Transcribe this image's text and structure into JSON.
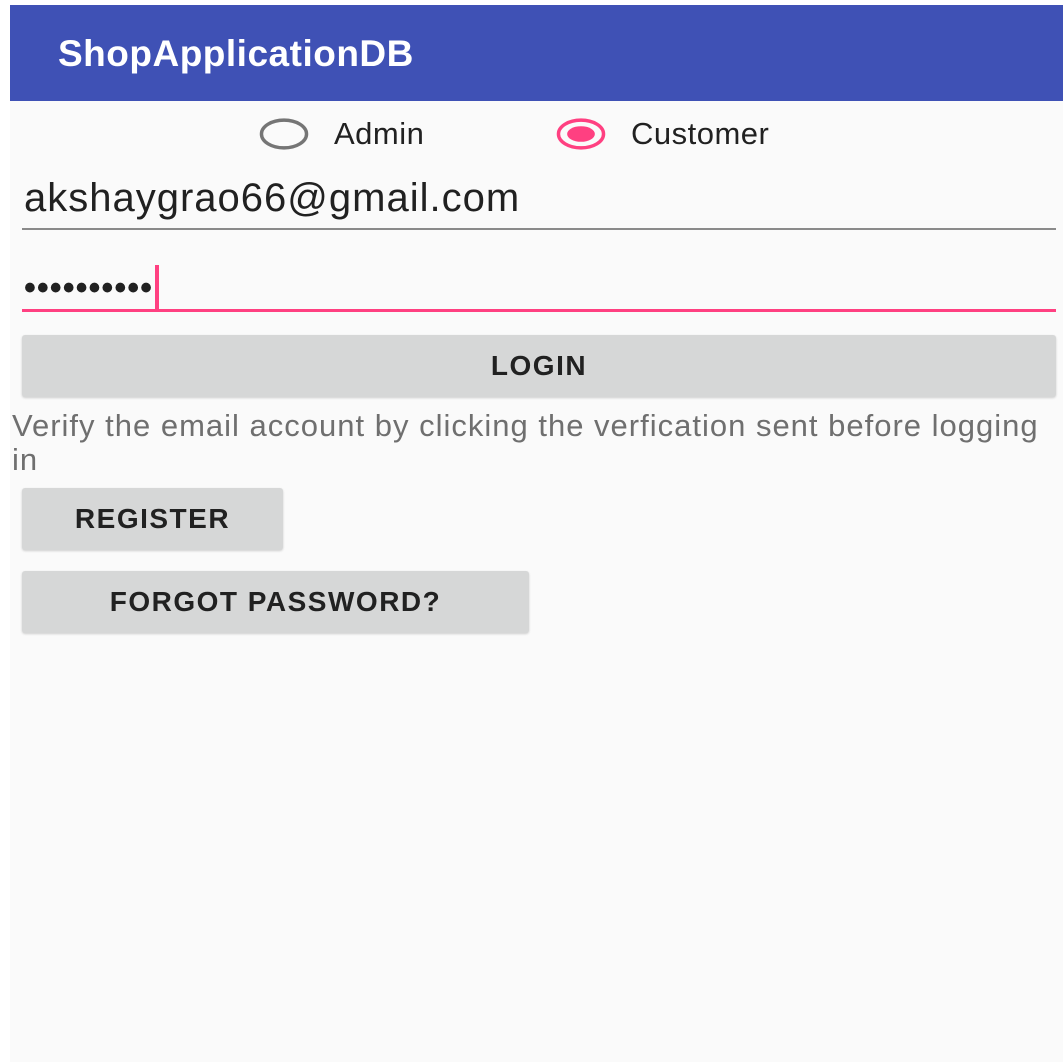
{
  "app": {
    "title": "ShopApplicationDB"
  },
  "role_selector": {
    "options": [
      {
        "label": "Admin",
        "selected": false
      },
      {
        "label": "Customer",
        "selected": true
      }
    ]
  },
  "email": {
    "value": "akshaygrao66@gmail.com"
  },
  "password": {
    "masked_value": "••••••••••"
  },
  "buttons": {
    "login": "LOGIN",
    "register": "REGISTER",
    "forgot_password": "FORGOT PASSWORD?"
  },
  "notice": {
    "text": "Verify the email account by clicking the verfication sent before logging in"
  },
  "colors": {
    "appbar": "#3f51b5",
    "accent": "#ff4081",
    "button_bg": "#d6d7d7",
    "background": "#fafafa"
  }
}
